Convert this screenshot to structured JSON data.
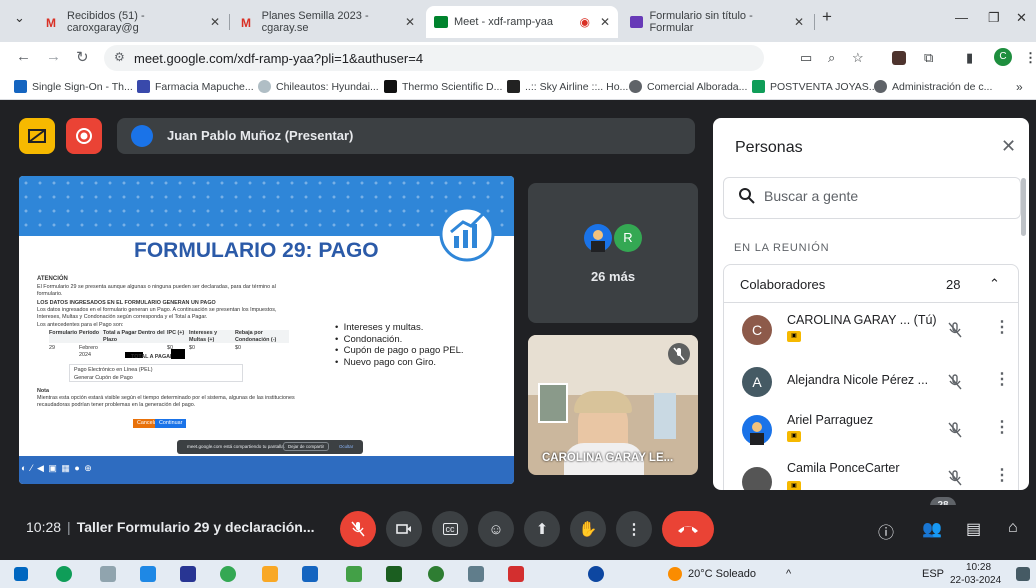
{
  "browser": {
    "tabs": [
      {
        "title": "Recibidos (51) - caroxgaray@g",
        "active": false
      },
      {
        "title": "Planes Semilla 2023 - cgaray.se",
        "active": false
      },
      {
        "title": "Meet - xdf-ramp-yaa",
        "active": true
      },
      {
        "title": "Formulario sin título - Formular",
        "active": false
      }
    ],
    "url": "meet.google.com/xdf-ramp-yaa?pli=1&authuser=4",
    "profile_initial": "C",
    "bookmarks": [
      "Single Sign-On - Th...",
      "Farmacia Mapuche...",
      "Chileautos: Hyundai...",
      "Thermo Scientific D...",
      "..:: Sky Airline ::.. Ho...",
      "Comercial Alborada...",
      "POSTVENTA JOYAS...",
      "Administración de c..."
    ]
  },
  "meet": {
    "presenter_label": "Juan Pablo Muñoz (Presentar)",
    "slide": {
      "title": "FORMULARIO 29: PAGO",
      "atencion_heading": "ATENCIÓN",
      "atencion_text": "El Formulario 29 se presenta aunque algunas o ninguna pueden ser declaradas, para dar término al formulario.",
      "section_heading": "LOS DATOS INGRESADOS EN EL FORMULARIO GENERAN UN PAGO",
      "section_text": "Los datos ingresados en el formulario generan un Pago. A continuación se presentan los Impuestos, Intereses, Multas y Condonación según corresponda y el Total a Pagar.",
      "table_intro": "Los antecedentes para el Pago son:",
      "table_headers": [
        "Formulario",
        "Período",
        "Total a Pagar Dentro del Plazo",
        "IPC (+)",
        "Intereses y Multas (+)",
        "Rebaja por Condonación (-)"
      ],
      "table_row": [
        "29",
        "Febrero 2024",
        "",
        "$0",
        "$0",
        "$0"
      ],
      "total_label": "TOTAL A PAGAR (=)",
      "payment_opt1": "Pago Electrónico en Línea (PEL)",
      "payment_opt2": "Generar Cupón de Pago",
      "nota_heading": "Nota",
      "nota_text": "Mientras esta opción estará visible según el tiempo determinado por el sistema, algunas de las instituciones recaudadoras podrían tener problemas en la generación del pago.",
      "btn_left": "Cancelar",
      "btn_right": "Continuar",
      "bullets": [
        "Intereses y multas.",
        "Condonación.",
        "Cupón de pago o pago PEL.",
        "Nuevo pago con Giro."
      ],
      "toast_text": "meet.google.com está compartiendo tu pantalla.",
      "toast_stop": "Dejar de compartir",
      "toast_hide": "Ocultar",
      "controls_text": "◐ ⁄ ◀ ▣ ▦ ● ⊕"
    },
    "more_participants": "26 más",
    "avatar_r": "R",
    "camera_name": "CAROLINA GARAY LE...",
    "meeting_time": "10:28",
    "meeting_title": "Taller Formulario 29 y declaración...",
    "people_count_badge": "28"
  },
  "people_panel": {
    "title": "Personas",
    "search_placeholder": "Buscar a gente",
    "section_label": "EN LA REUNIÓN",
    "group_label": "Colaboradores",
    "group_count": "28",
    "people": [
      {
        "initial": "C",
        "name": "CAROLINA GARAY ... (Tú)",
        "color": "#8d5a4a",
        "badge": true
      },
      {
        "initial": "A",
        "name": "Alejandra Nicole Pérez ...",
        "color": "#455a64",
        "badge": false
      },
      {
        "initial": "",
        "name": "Ariel Parraguez",
        "color": "#1a73e8",
        "badge": true
      },
      {
        "initial": "",
        "name": "Camila PonceCarter",
        "color": "#555555",
        "badge": true
      }
    ]
  },
  "taskbar": {
    "weather": "20°C Soleado",
    "lang": "ESP",
    "time": "10:28",
    "date": "22-03-2024"
  },
  "colors": {
    "meet_bg": "#202124",
    "tile_bg": "#3c4043",
    "red": "#ea4335",
    "slide_blue": "#2f86d8",
    "slide_title": "#2b5aa8"
  }
}
